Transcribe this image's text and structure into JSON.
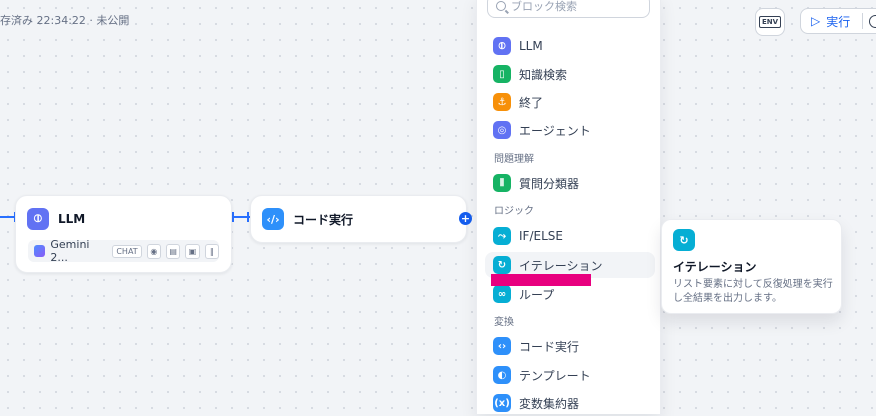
{
  "status_text": "存済み 22:34:22 · 未公開",
  "toolbar": {
    "env_label": "ENV",
    "run_label": "実行"
  },
  "nodes": {
    "llm": {
      "title": "LLM",
      "model": "Gemini 2...",
      "model_badge": "CHAT"
    },
    "code": {
      "title": "コード実行"
    }
  },
  "panel": {
    "search_placeholder": "ブロック検索",
    "items_top": [
      {
        "label": "LLM",
        "icon": "llm-icon"
      },
      {
        "label": "知識検索",
        "icon": "book-icon"
      },
      {
        "label": "終了",
        "icon": "end-icon"
      },
      {
        "label": "エージェント",
        "icon": "agent-icon"
      }
    ],
    "cat_understanding": "問題理解",
    "item_classifier": "質問分類器",
    "cat_logic": "ロジック",
    "item_ifelse": "IF/ELSE",
    "item_iteration": "イテレーション",
    "item_loop": "ループ",
    "cat_transform": "変換",
    "item_code": "コード実行",
    "item_template": "テンプレート",
    "item_var": "変数集約器"
  },
  "tooltip": {
    "title": "イテレーション",
    "description": "リスト要素に対して反復処理を実行し全結果を出力します。"
  },
  "colors": {
    "accent": "#155eef",
    "highlight_mark": "#e8007f"
  }
}
